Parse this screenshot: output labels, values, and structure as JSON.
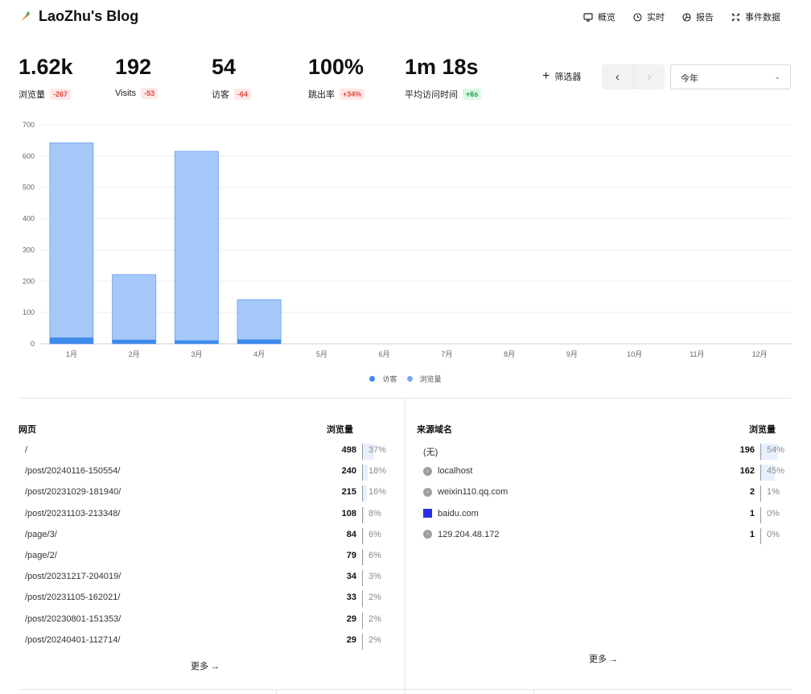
{
  "header": {
    "title": "LaoZhu's Blog",
    "nav": [
      {
        "label": "概览",
        "icon": "monitor-icon"
      },
      {
        "label": "实时",
        "icon": "clock-icon"
      },
      {
        "label": "报告",
        "icon": "pie-chart-icon"
      },
      {
        "label": "事件数据",
        "icon": "events-icon"
      }
    ]
  },
  "metrics": [
    {
      "value": "1.62k",
      "label": "浏览量",
      "change": "-267",
      "trend": "neg"
    },
    {
      "value": "192",
      "label": "Visits",
      "change": "-53",
      "trend": "neg"
    },
    {
      "value": "54",
      "label": "访客",
      "change": "-64",
      "trend": "neg"
    },
    {
      "value": "100%",
      "label": "跳出率",
      "change": "+34%",
      "trend": "neg"
    },
    {
      "value": "1m 18s",
      "label": "平均访问时间",
      "change": "+6s",
      "trend": "pos"
    }
  ],
  "controls": {
    "filter_label": "筛选器",
    "prev_label": "‹",
    "next_label": "›",
    "period": "今年"
  },
  "colors": {
    "visitors": "#3d8bea",
    "pageviews": "#a6c8f8",
    "pageviews_border": "#78a9f0"
  },
  "chart_data": {
    "type": "bar",
    "categories": [
      "1月",
      "2月",
      "3月",
      "4月",
      "5月",
      "6月",
      "7月",
      "8月",
      "9月",
      "10月",
      "11月",
      "12月"
    ],
    "series": [
      {
        "name": "访客",
        "values": [
          20,
          13,
          11,
          14,
          0,
          0,
          0,
          0,
          0,
          0,
          0,
          0
        ]
      },
      {
        "name": "浏览量",
        "values": [
          642,
          221,
          615,
          141,
          0,
          0,
          0,
          0,
          0,
          0,
          0,
          0
        ]
      }
    ],
    "ylim": [
      0,
      700
    ],
    "yticks": [
      0,
      100,
      200,
      300,
      400,
      500,
      600,
      700
    ],
    "grid": true,
    "legend": "bottom-center"
  },
  "pages": {
    "header_label": "网页",
    "metric_label": "浏览量",
    "rows": [
      {
        "label": "/",
        "value": "498",
        "pct": "37%",
        "frac": 0.37
      },
      {
        "label": "/post/20240116-150554/",
        "value": "240",
        "pct": "18%",
        "frac": 0.18
      },
      {
        "label": "/post/20231029-181940/",
        "value": "215",
        "pct": "16%",
        "frac": 0.16
      },
      {
        "label": "/post/20231103-213348/",
        "value": "108",
        "pct": "8%",
        "frac": 0.08
      },
      {
        "label": "/page/3/",
        "value": "84",
        "pct": "6%",
        "frac": 0.06
      },
      {
        "label": "/page/2/",
        "value": "79",
        "pct": "6%",
        "frac": 0.06
      },
      {
        "label": "/post/20231217-204019/",
        "value": "34",
        "pct": "3%",
        "frac": 0.03
      },
      {
        "label": "/post/20231105-162021/",
        "value": "33",
        "pct": "2%",
        "frac": 0.02
      },
      {
        "label": "/post/20230801-151353/",
        "value": "29",
        "pct": "2%",
        "frac": 0.02
      },
      {
        "label": "/post/20240401-112714/",
        "value": "29",
        "pct": "2%",
        "frac": 0.02
      }
    ],
    "more_label": "更多 →"
  },
  "referrers": {
    "header_label": "来源域名",
    "metric_label": "浏览量",
    "rows": [
      {
        "label": "(无)",
        "value": "196",
        "pct": "54%",
        "frac": 0.54,
        "icon": "none"
      },
      {
        "label": "localhost",
        "value": "162",
        "pct": "45%",
        "frac": 0.45,
        "icon": "globe-icon"
      },
      {
        "label": "weixin110.qq.com",
        "value": "2",
        "pct": "1%",
        "frac": 0.01,
        "icon": "globe-icon"
      },
      {
        "label": "baidu.com",
        "value": "1",
        "pct": "0%",
        "frac": 0.0,
        "icon": "baidu-icon"
      },
      {
        "label": "129.204.48.172",
        "value": "1",
        "pct": "0%",
        "frac": 0.0,
        "icon": "globe-icon"
      }
    ],
    "more_label": "更多 →"
  }
}
